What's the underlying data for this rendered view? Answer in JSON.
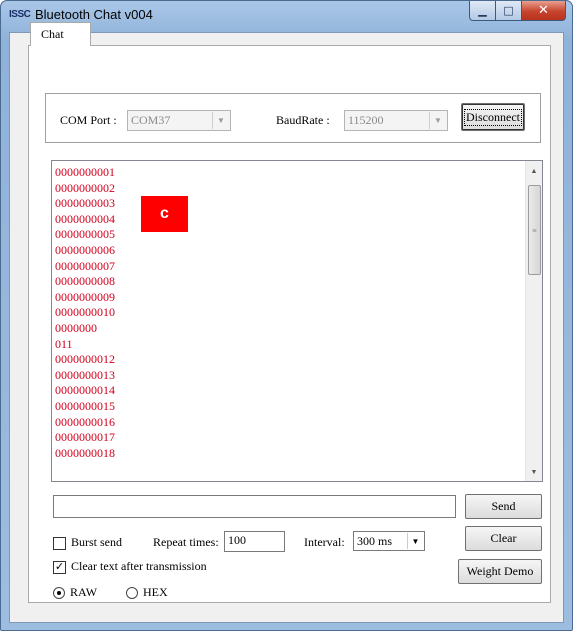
{
  "window": {
    "app_icon_text": "ISSC",
    "title": "Bluetooth Chat v004",
    "minimize_glyph": "▁",
    "maximize_glyph": "□",
    "close_glyph": "✕"
  },
  "tabs": [
    {
      "label": "Chat",
      "selected": true
    }
  ],
  "connection": {
    "com_port_label": "COM Port :",
    "com_port_value": "COM37",
    "baudrate_label": "BaudRate :",
    "baudrate_value": "115200",
    "disconnect_label": "Disconnect"
  },
  "output": {
    "lines": [
      "0000000001",
      "0000000002",
      "0000000003",
      "0000000004",
      "0000000005",
      "0000000006",
      "0000000007",
      "0000000008",
      "0000000009",
      "0000000010",
      "0000000",
      "011",
      "0000000012",
      "0000000013",
      "0000000014",
      "0000000015",
      "0000000016",
      "0000000017",
      "0000000018"
    ],
    "text_color": "#d1001c",
    "badge_text": "c",
    "badge_color": "#ff0000"
  },
  "send": {
    "input_value": "",
    "send_label": "Send",
    "clear_label": "Clear",
    "weight_demo_label": "Weight Demo"
  },
  "options": {
    "burst_send_label": "Burst send",
    "burst_send_checked": false,
    "repeat_times_label": "Repeat times:",
    "repeat_times_value": "100",
    "interval_label": "Interval:",
    "interval_value": "300 ms",
    "clear_after_label": "Clear text after transmission",
    "clear_after_checked": true,
    "raw_label": "RAW",
    "hex_label": "HEX",
    "mode_selected": "RAW"
  },
  "icons": {
    "dropdown_arrow": "▼",
    "scroll_up": "▲",
    "scroll_down": "▼",
    "scroll_grip": "≡",
    "check": "✓"
  }
}
